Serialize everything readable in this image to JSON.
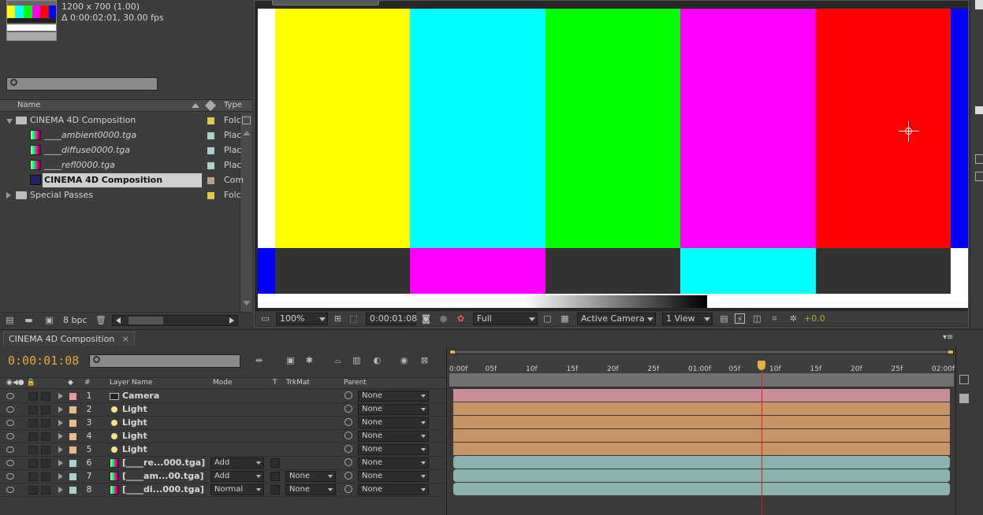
{
  "project_panel": {
    "info_lines": [
      "1200 x 700 (1.00)",
      "Δ 0:00:02:01, 30.00 fps"
    ],
    "search_placeholder": "",
    "columns": {
      "name": "Name",
      "type": "Type"
    },
    "items": [
      {
        "label": "CINEMA 4D Composition",
        "type": "Folc",
        "kind": "folder",
        "open": true,
        "indent": 0,
        "swatch": "#e3c94a"
      },
      {
        "label": "____ambient0000.tga",
        "type": "Plac",
        "kind": "tga",
        "indent": 1,
        "swatch": "#a9d0cc"
      },
      {
        "label": "____diffuse0000.tga",
        "type": "Plac",
        "kind": "tga",
        "indent": 1,
        "swatch": "#a9d0cc"
      },
      {
        "label": "____refl0000.tga",
        "type": "Plac",
        "kind": "tga",
        "indent": 1,
        "swatch": "#a9d0cc"
      },
      {
        "label": "CINEMA 4D Composition",
        "type": "Com",
        "kind": "comp",
        "indent": 1,
        "swatch": "#b3a387",
        "selected": true
      },
      {
        "label": "Special Passes",
        "type": "Folc",
        "kind": "folder",
        "open": false,
        "indent": 0,
        "swatch": "#e3c94a"
      }
    ],
    "bpc": "8 bpc"
  },
  "viewer": {
    "zoom": "100%",
    "timecode": "0:00:01:08",
    "resolution": "Full",
    "camera": "Active Camera",
    "views": "1 View",
    "exposure": "+0.0",
    "colors": {
      "yellow": "#ffff00",
      "cyan": "#00ffff",
      "green": "#00ff00",
      "magenta": "#ff00ff",
      "red": "#ff0000",
      "blue": "#0000ff",
      "dark": "#333333",
      "white": "#ffffff"
    }
  },
  "timeline": {
    "tab": "CINEMA 4D Composition",
    "timecode": "0:00:01:08",
    "headers": {
      "num": "#",
      "layer_name": "Layer Name",
      "mode": "Mode",
      "t": "T",
      "trkmat": "TrkMat",
      "parent": "Parent"
    },
    "ruler_ticks": [
      "0:00f",
      "05f",
      "10f",
      "15f",
      "20f",
      "25f",
      "01:00f",
      "05f",
      "10f",
      "15f",
      "20f",
      "25f",
      "02:00f"
    ],
    "layers": [
      {
        "num": "1",
        "name": "Camera",
        "kind": "camera",
        "swatch": "#e39aa5",
        "mode": "",
        "trkmat": "",
        "parent": "None",
        "bar": "#c98f99"
      },
      {
        "num": "2",
        "name": "Light",
        "kind": "light",
        "swatch": "#e8b98a",
        "mode": "",
        "trkmat": "",
        "parent": "None",
        "bar": "#c89366"
      },
      {
        "num": "3",
        "name": "Light",
        "kind": "light",
        "swatch": "#e8b98a",
        "mode": "",
        "trkmat": "",
        "parent": "None",
        "bar": "#c89366"
      },
      {
        "num": "4",
        "name": "Light",
        "kind": "light",
        "swatch": "#e8b98a",
        "mode": "",
        "trkmat": "",
        "parent": "None",
        "bar": "#c89366"
      },
      {
        "num": "5",
        "name": "Light",
        "kind": "light",
        "swatch": "#e8b98a",
        "mode": "",
        "trkmat": "",
        "parent": "None",
        "bar": "#c89366"
      },
      {
        "num": "6",
        "name": "[____re...000.tga]",
        "kind": "tga",
        "swatch": "#a9d0cc",
        "mode": "Add",
        "trkmat": "",
        "parent": "None",
        "bar": "#8bb3ad"
      },
      {
        "num": "7",
        "name": "[____am...00.tga]",
        "kind": "tga",
        "swatch": "#a9d0cc",
        "mode": "Add",
        "trkmat": "None",
        "parent": "None",
        "bar": "#8bb3ad"
      },
      {
        "num": "8",
        "name": "[____di...000.tga]",
        "kind": "tga",
        "swatch": "#a9d0cc",
        "mode": "Normal",
        "trkmat": "None",
        "parent": "None",
        "bar": "#8bb3ad"
      }
    ]
  }
}
